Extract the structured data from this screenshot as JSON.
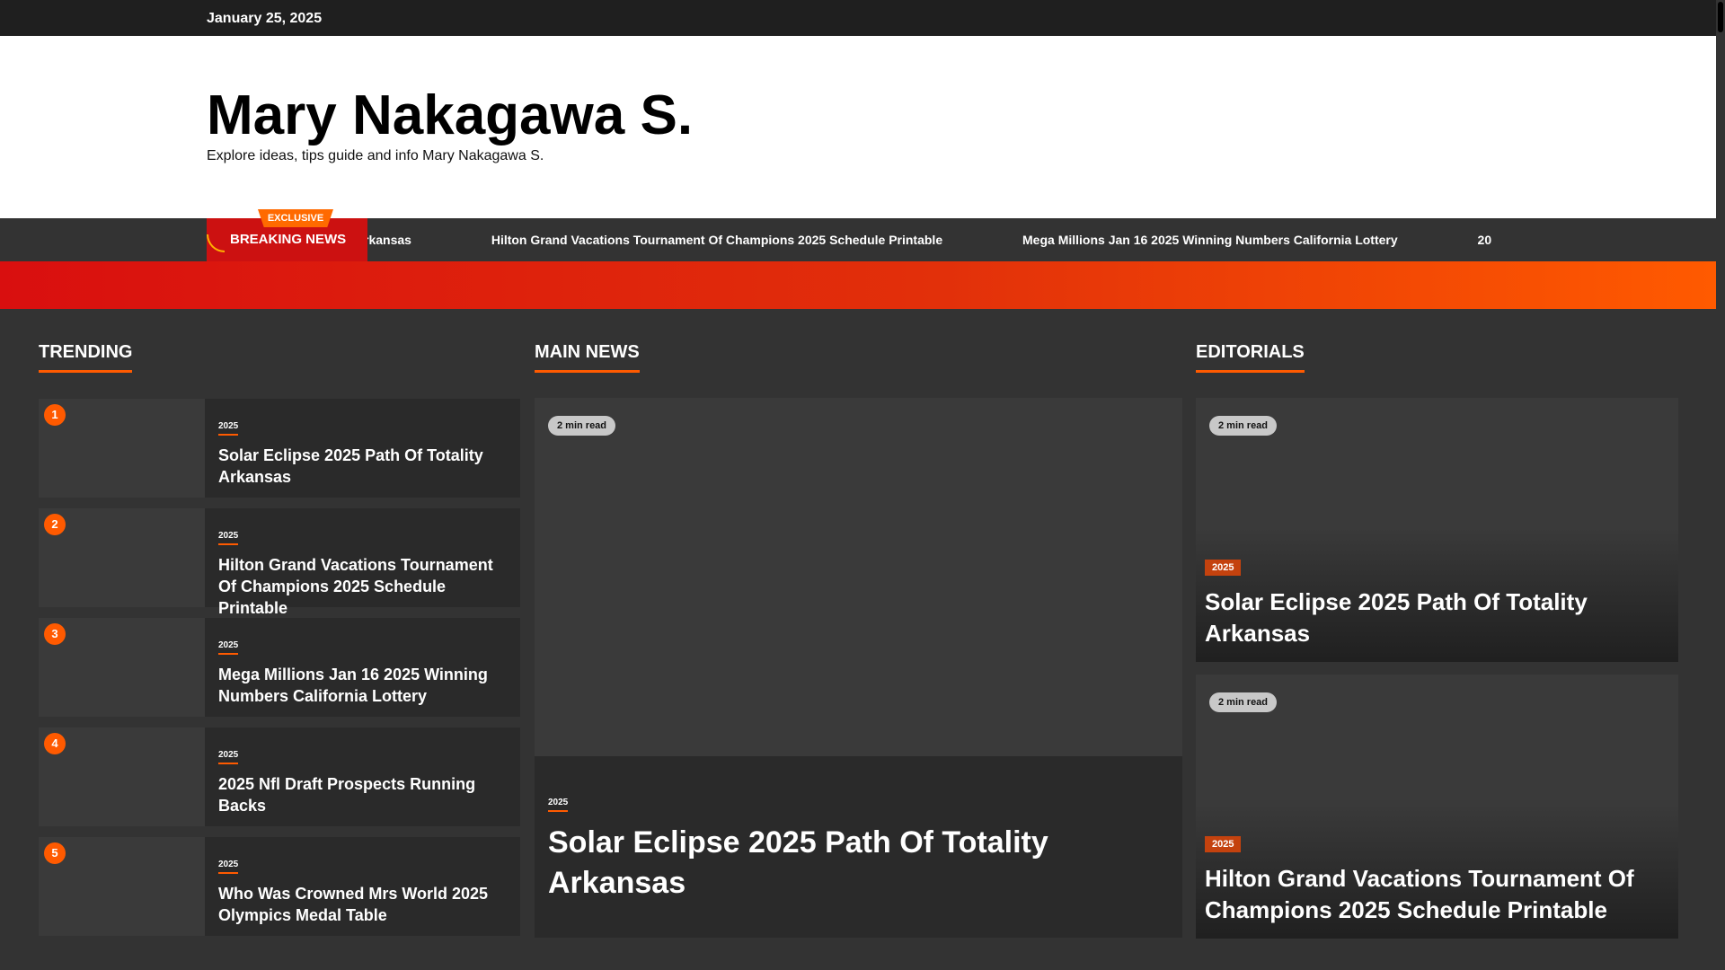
{
  "topbar": {
    "date": "January 25, 2025"
  },
  "brand": {
    "title": "Mary Nakagawa S.",
    "tagline": "Explore ideas, tips guide and info Mary Nakagawa S."
  },
  "ticker": {
    "badge": "BREAKING NEWS",
    "exclusive": "EXCLUSIVE",
    "items": [
      "rkansas",
      "Hilton Grand Vacations Tournament Of Champions 2025 Schedule Printable",
      "Mega Millions Jan 16 2025 Winning Numbers California Lottery",
      "20"
    ]
  },
  "sections": {
    "trending": "TRENDING",
    "main_news": "MAIN NEWS",
    "editorials": "EDITORIALS"
  },
  "trending": [
    {
      "rank": "1",
      "category": "2025",
      "title": "Solar Eclipse 2025 Path Of Totality Arkansas"
    },
    {
      "rank": "2",
      "category": "2025",
      "title": "Hilton Grand Vacations Tournament Of Champions 2025 Schedule Printable"
    },
    {
      "rank": "3",
      "category": "2025",
      "title": "Mega Millions Jan 16 2025 Winning Numbers California Lottery"
    },
    {
      "rank": "4",
      "category": "2025",
      "title": "2025 Nfl Draft Prospects Running Backs"
    },
    {
      "rank": "5",
      "category": "2025",
      "title": "Who Was Crowned Mrs World 2025 Olympics Medal Table"
    }
  ],
  "main": {
    "read_time": "2 min read",
    "category": "2025",
    "title": "Solar Eclipse 2025 Path Of Totality Arkansas"
  },
  "editorials": [
    {
      "read_time": "2 min read",
      "category": "2025",
      "title": "Solar Eclipse 2025 Path Of Totality Arkansas"
    },
    {
      "read_time": "2 min read",
      "category": "2025",
      "title": "Hilton Grand Vacations Tournament Of Champions 2025 Schedule Printable"
    }
  ],
  "colors": {
    "accent": "#ff5a00",
    "breaking": "#cc1111",
    "background": "#333333"
  }
}
